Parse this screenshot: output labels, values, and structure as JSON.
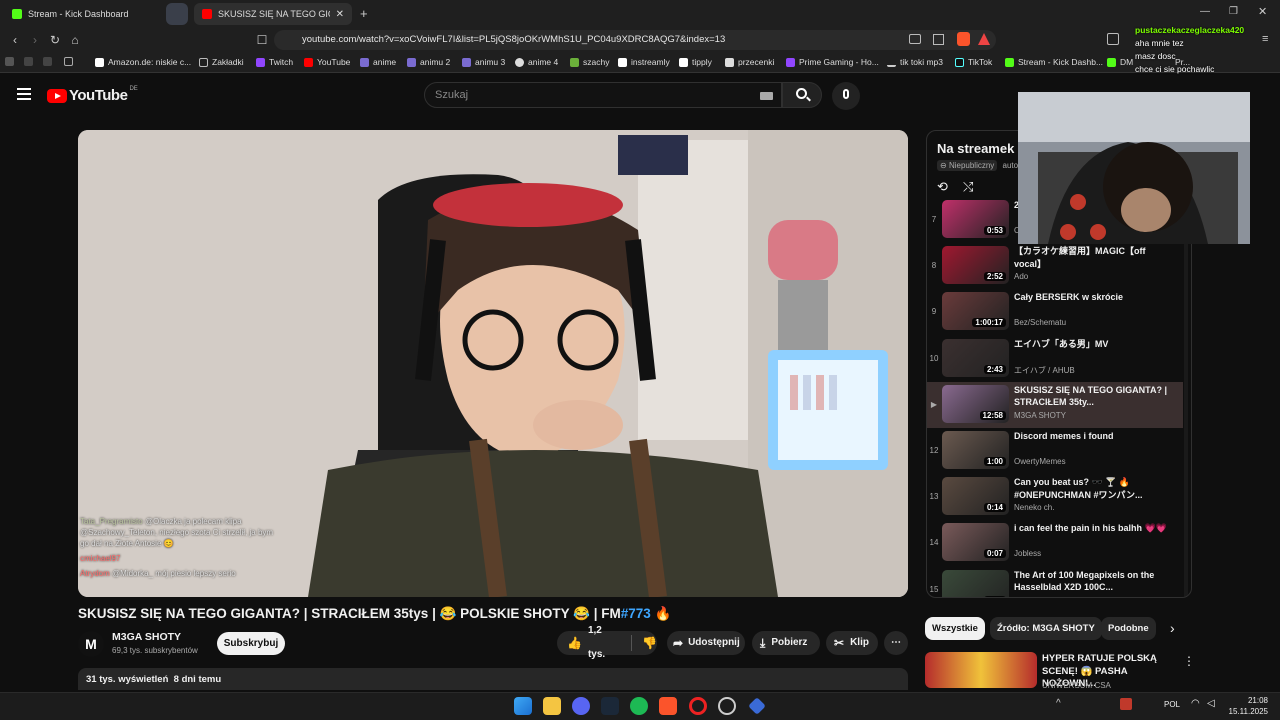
{
  "browser": {
    "tabs": [
      {
        "title": "Stream - Kick Dashboard"
      },
      {
        "title": "SKUSISZ SIĘ NA TEGO GIGANTA?",
        "active": true
      }
    ],
    "url": "youtube.com/watch?v=xoCVoiwFL7I&list=PL5jQS8joOKrWMhS1U_PC04u9XDRC8AQG7&index=13",
    "bookmarks": [
      "Amazon.de: niskie c...",
      "Zakładki",
      "Twitch",
      "YouTube",
      "anime",
      "animu 2",
      "animu 3",
      "anime 4",
      "szachy",
      "instreamly",
      "tipply",
      "przecenki",
      "Prime Gaming - Ho...",
      "tik toki mp3",
      "TikTok",
      "Stream - Kick Dashb...",
      "DM",
      "Pr..."
    ]
  },
  "youtube": {
    "logo_text": "YouTube",
    "region": "DE",
    "search_placeholder": "Szukaj"
  },
  "video": {
    "title_main": "SKUSISZ SIĘ NA TEGO GIGANTA? | STRACIŁEM 35tys | 😂 POLSKIE SHOTY 😂 | FM",
    "title_tag": "#773",
    "title_end": " 🔥",
    "overlay_chat": [
      {
        "user": "Tata_Pregramisto",
        "text": "@Olaczka ja polecam klipa"
      },
      {
        "user": "",
        "text": "@Szachowy_Teleton, niezłego szota Ci strzelił, ja bym"
      },
      {
        "user": "",
        "text": "go dał na Złote Antosie 😊"
      },
      {
        "user": "cmichael97",
        "text": ""
      },
      {
        "user": "Atrydom",
        "text": "@Midorka_ mój piesio lepszy serio"
      }
    ]
  },
  "channel": {
    "avatar_letter": "M",
    "name": "M3GA SHOTY",
    "subs": "69,3 tys. subskrybentów",
    "subscribe_label": "Subskrybuj"
  },
  "actions": {
    "likes": "1,2 tys.",
    "share": "Udostępnij",
    "download": "Pobierz",
    "clip": "Klip"
  },
  "description": {
    "views": "31 tys. wyświetleń",
    "date": "8 dni temu"
  },
  "playlist": {
    "title": "Na streamek",
    "privacy": "Niepubliczny",
    "auto": "auto",
    "items": [
      {
        "index": "7",
        "duration": "0:53",
        "title": "2...",
        "channel": "O...",
        "color": "#c0306a"
      },
      {
        "index": "8",
        "duration": "2:52",
        "title": "【カラオケ練習用】MAGIC【off vocal】",
        "channel": "Ado",
        "color": "#a01830"
      },
      {
        "index": "9",
        "duration": "1:00:17",
        "title": "Cały BERSERK w skrócie",
        "channel": "Bez/Schematu",
        "color": "#6a3b3b"
      },
      {
        "index": "10",
        "duration": "2:43",
        "title": "エイハブ「ある男」MV",
        "channel": "エイハブ / AHUB",
        "color": "#3b3030"
      },
      {
        "index": "▶",
        "duration": "12:58",
        "title": "SKUSISZ SIĘ NA TEGO GIGANTA? | STRACIŁEM 35ty...",
        "channel": "M3GA SHOTY",
        "color": "#8a6a90",
        "current": true
      },
      {
        "index": "12",
        "duration": "1:00",
        "title": "Discord memes i found",
        "channel": "OwertyMemes",
        "color": "#6b5a50"
      },
      {
        "index": "13",
        "duration": "0:14",
        "title": "Can you beat us? 🕶️ 🍸 🔥 #ONEPUNCHMAN #ワンパン...",
        "channel": "Neneko ch.",
        "color": "#5a4a40"
      },
      {
        "index": "14",
        "duration": "0:07",
        "title": "i can feel the pain in his balhh 💗💗",
        "channel": "Jobless",
        "color": "#7a5a5a"
      },
      {
        "index": "15",
        "duration": "0:14",
        "title": "The Art of 100 Megapixels on the Hasselblad X2D 100C...",
        "channel": "Maciej Lubomski",
        "color": "#3a4a3a"
      }
    ]
  },
  "chips": [
    "Wszystkie",
    "Źródło: M3GA SHOTY",
    "Podobne"
  ],
  "recommended": {
    "title": "HYPER RATUJE POLSKĄ SCENĘ! 😱 PASHA NOŻOWNI...",
    "channel": "UNIWERSUM CSA"
  },
  "stream_chat": {
    "user": "pustaczekaczeglaczeka420",
    "lines": [
      "aha mnie tez",
      "masz dosc",
      "chce ci sie pochawlic"
    ]
  },
  "taskbar": {
    "lang": "POL",
    "time": "21:08",
    "date": "15.11.2025"
  },
  "colors": {
    "yt_red": "#ff0000",
    "link_blue": "#3ea6ff",
    "bg": "#0f0f0f"
  }
}
